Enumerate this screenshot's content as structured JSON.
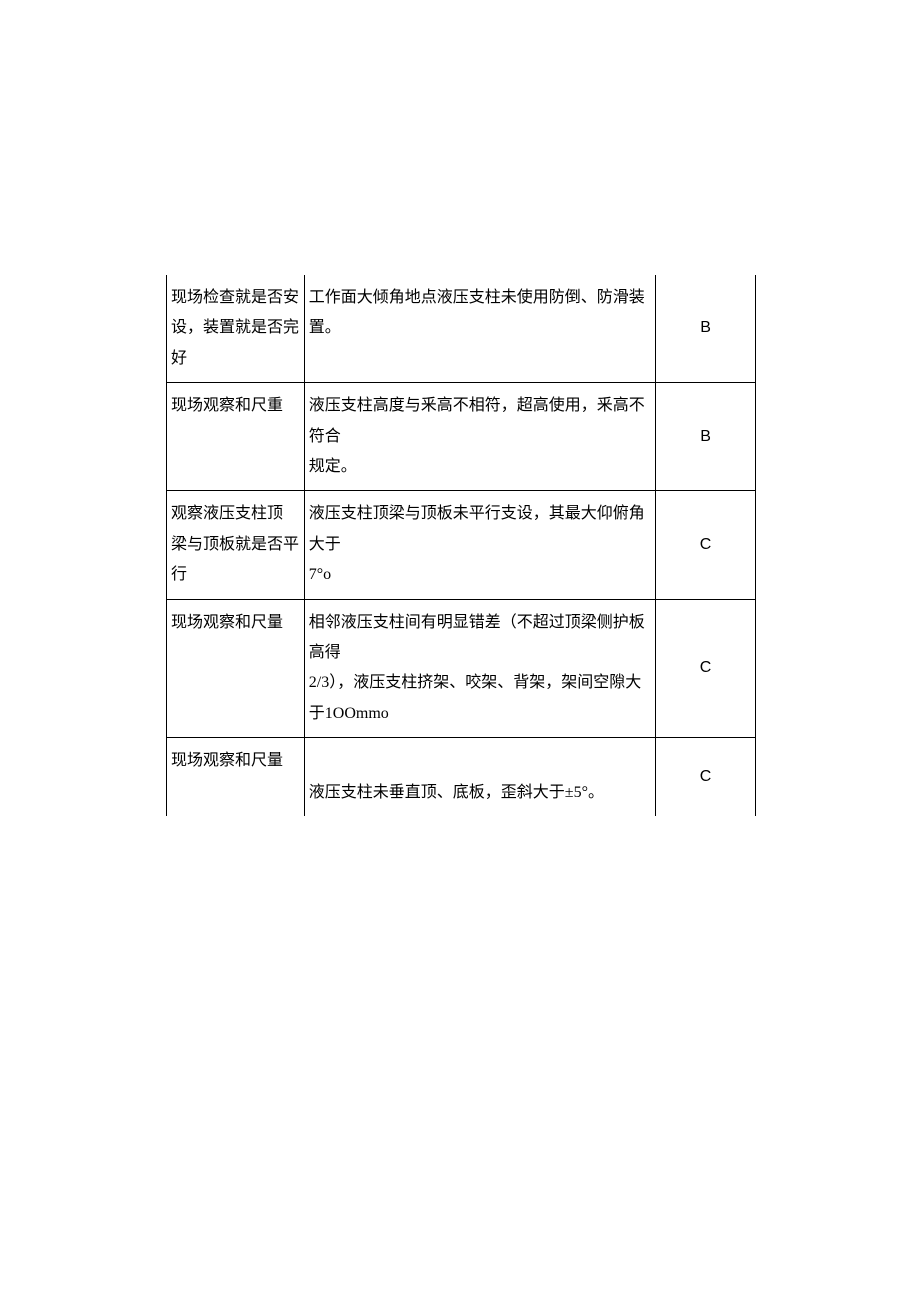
{
  "rows": [
    {
      "col1": "现场检查就是否安\n设，装置就是否完\n好",
      "col2": "工作面大倾角地点液压支柱未使用防倒、防滑装置。",
      "col3": "B"
    },
    {
      "col1": "现场观察和尺重",
      "col2": "液压支柱高度与釆高不相符，超高使用，釆高不符合\n规定。",
      "col3": "B"
    },
    {
      "col1": "观察液压支柱顶\n梁与顶板就是否平\n行",
      "col2": "液压支柱顶梁与顶板未平行支设，其最大仰俯角大于\n7°o",
      "col3": "C"
    },
    {
      "col1": "现场观察和尺量",
      "col2": "相邻液压支柱间有明显错差（不超过顶梁侧护板高得\n2/3），液压支柱挤架、咬架、背架，架间空隙大于1OOmmo",
      "col3": "C"
    },
    {
      "col1": "现场观察和尺量",
      "col2": "液压支柱未垂直顶、底板，歪斜大于±5°。",
      "col3": "C"
    }
  ]
}
